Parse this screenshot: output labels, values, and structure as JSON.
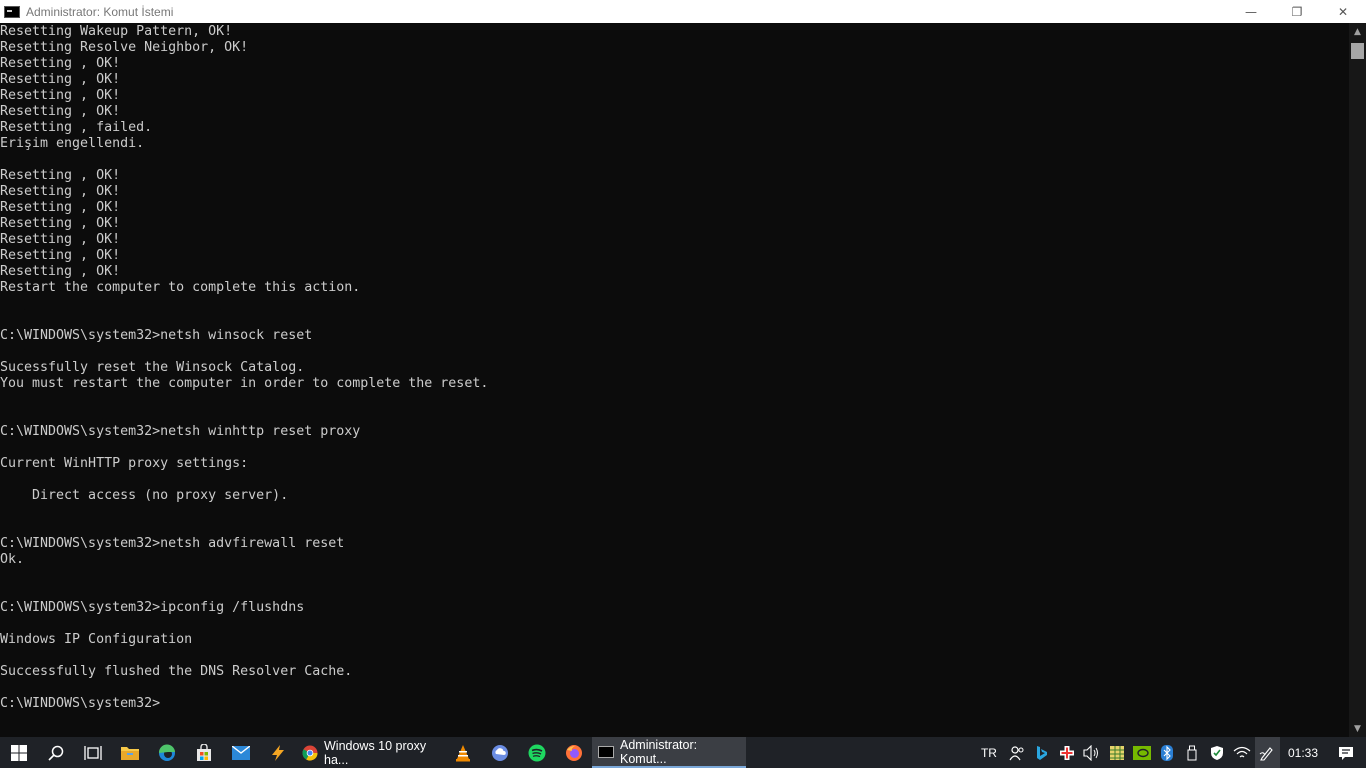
{
  "window": {
    "title": "Administrator: Komut İstemi",
    "minimize": "—",
    "restore": "❐",
    "close": "✕"
  },
  "console": {
    "lines": [
      "Resetting Wakeup Pattern, OK!",
      "Resetting Resolve Neighbor, OK!",
      "Resetting , OK!",
      "Resetting , OK!",
      "Resetting , OK!",
      "Resetting , OK!",
      "Resetting , failed.",
      "Erişim engellendi.",
      "",
      "Resetting , OK!",
      "Resetting , OK!",
      "Resetting , OK!",
      "Resetting , OK!",
      "Resetting , OK!",
      "Resetting , OK!",
      "Resetting , OK!",
      "Restart the computer to complete this action.",
      "",
      "",
      "C:\\WINDOWS\\system32>netsh winsock reset",
      "",
      "Sucessfully reset the Winsock Catalog.",
      "You must restart the computer in order to complete the reset.",
      "",
      "",
      "C:\\WINDOWS\\system32>netsh winhttp reset proxy",
      "",
      "Current WinHTTP proxy settings:",
      "",
      "    Direct access (no proxy server).",
      "",
      "",
      "C:\\WINDOWS\\system32>netsh advfirewall reset",
      "Ok.",
      "",
      "",
      "C:\\WINDOWS\\system32>ipconfig /flushdns",
      "",
      "Windows IP Configuration",
      "",
      "Successfully flushed the DNS Resolver Cache.",
      "",
      "C:\\WINDOWS\\system32>"
    ]
  },
  "taskbar": {
    "tasks": [
      {
        "label": "Windows 10 proxy ha...",
        "icon": "chrome-icon"
      },
      {
        "label": "Administrator: Komut...",
        "icon": "cmd-icon"
      }
    ],
    "language": "TR",
    "time": "01:33"
  },
  "colors": {
    "console_bg": "#0c0c0c",
    "console_fg": "#cccccc",
    "taskbar_bg": "#1f2227"
  }
}
